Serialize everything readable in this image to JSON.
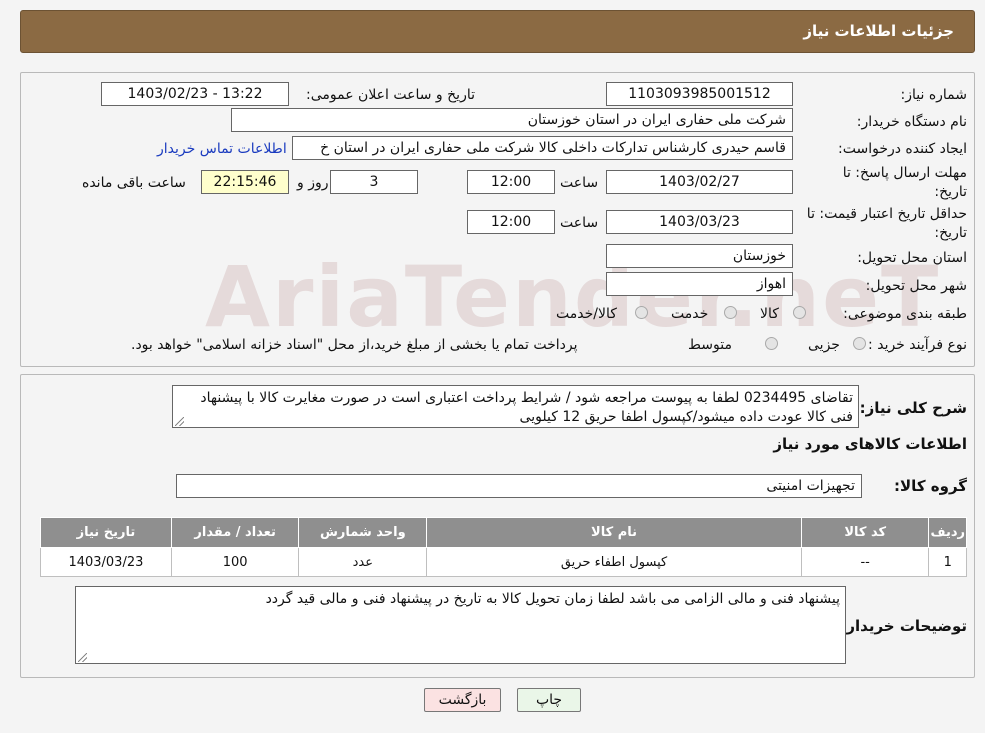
{
  "header": {
    "title": "جزئیات اطلاعات نیاز"
  },
  "watermark": "AriaTender.neT",
  "form": {
    "need_number_label": "شماره نیاز:",
    "need_number": "1103093985001512",
    "announce_label": "تاریخ و ساعت اعلان عمومی:",
    "announce_value": "1403/02/23 - 13:22",
    "buyer_org_label": "نام دستگاه خریدار:",
    "buyer_org": "شرکت ملی حفاری ایران در استان خوزستان",
    "creator_label": "ایجاد کننده درخواست:",
    "creator": "قاسم حیدری کارشناس تدارکات داخلی کالا شرکت ملی حفاری ایران در استان خ",
    "contact_link": "اطلاعات تماس خریدار",
    "deadline_label_1": "مهلت ارسال پاسخ: تا",
    "deadline_label_2": "تاریخ:",
    "deadline_date": "1403/02/27",
    "time_label": "ساعت",
    "deadline_time": "12:00",
    "days_value": "3",
    "days_label": "روز و",
    "remaining_time": "22:15:46",
    "remaining_label": "ساعت باقی مانده",
    "price_valid_label_1": "حداقل تاریخ اعتبار قیمت: تا",
    "price_valid_label_2": "تاریخ:",
    "price_valid_date": "1403/03/23",
    "price_valid_time": "12:00",
    "province_label": "استان محل تحویل:",
    "province": "خوزستان",
    "city_label": "شهر محل تحویل:",
    "city": "اهواز",
    "category_label": "طبقه بندی موضوعی:",
    "category_options": [
      "کالا",
      "خدمت",
      "کالا/خدمت"
    ],
    "process_label": "نوع فرآیند خرید :",
    "process_options": [
      "جزیی",
      "متوسط"
    ],
    "process_note": "پرداخت تمام یا بخشی از مبلغ خرید،از محل \"اسناد خزانه اسلامی\" خواهد بود."
  },
  "details": {
    "description_label": "شرح کلی نیاز:",
    "description": "تقاضای 0234495 لطفا به پیوست مراجعه شود / شرایط پرداخت اعتباری است در صورت مغایرت کالا با پیشنهاد فنی کالا عودت داده میشود/کپسول اطفا حریق 12 کیلویی",
    "goods_info_title": "اطلاعات کالاهای مورد نیاز",
    "goods_group_label": "گروه کالا:",
    "goods_group": "تجهیزات امنیتی",
    "table": {
      "headers": [
        "ردیف",
        "کد کالا",
        "نام کالا",
        "واحد شمارش",
        "تعداد / مقدار",
        "تاریخ نیاز"
      ],
      "rows": [
        [
          "1",
          "--",
          "کپسول اطفاء حریق",
          "عدد",
          "100",
          "1403/03/23"
        ]
      ]
    },
    "buyer_notes_label": "توضیحات خریدار:",
    "buyer_notes": "پیشنهاد فنی و مالی الزامی می باشد لطفا زمان تحویل کالا به تاریخ در پیشنهاد فنی و مالی قید گردد"
  },
  "buttons": {
    "print": "چاپ",
    "back": "بازگشت"
  }
}
